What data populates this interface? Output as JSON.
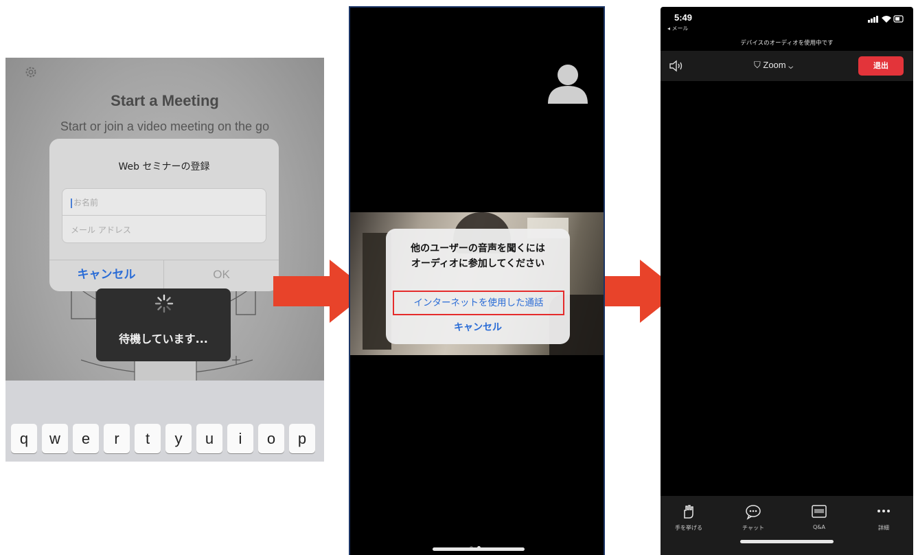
{
  "panel1": {
    "title": "Start a Meeting",
    "subtitle": "Start or join a video meeting on the go",
    "dialog": {
      "title": "Web セミナーの登録",
      "name_placeholder": "お名前",
      "email_placeholder": "メール アドレス",
      "cancel_label": "キャンセル",
      "ok_label": "OK"
    },
    "waiting_text": "待機しています...",
    "keyboard_keys": [
      "q",
      "w",
      "e",
      "r",
      "t",
      "y",
      "u",
      "i",
      "o",
      "p"
    ]
  },
  "panel2": {
    "alert": {
      "title_line1": "他のユーザーの音声を聞くには",
      "title_line2": "オーディオに参加してください",
      "internet_audio_label": "インターネットを使用した通話",
      "cancel_label": "キャンセル"
    },
    "page_indicator": {
      "count": 2,
      "active": 2
    }
  },
  "panel3": {
    "time": "5:49",
    "back_label": "◂ メール",
    "banner": "デバイスのオーディオを使用中です",
    "meeting_label": "Zoom",
    "leave_label": "退出",
    "toolbar": [
      {
        "label": "手を挙げる",
        "icon": "raise-hand-icon"
      },
      {
        "label": "チャット",
        "icon": "chat-icon"
      },
      {
        "label": "Q&A",
        "icon": "qa-icon"
      },
      {
        "label": "詳細",
        "icon": "more-icon"
      }
    ]
  },
  "colors": {
    "accent_blue": "#2a6cd6",
    "arrow_red": "#e8432a",
    "highlight_red": "#e52b2b",
    "leave_red": "#e3343a"
  }
}
